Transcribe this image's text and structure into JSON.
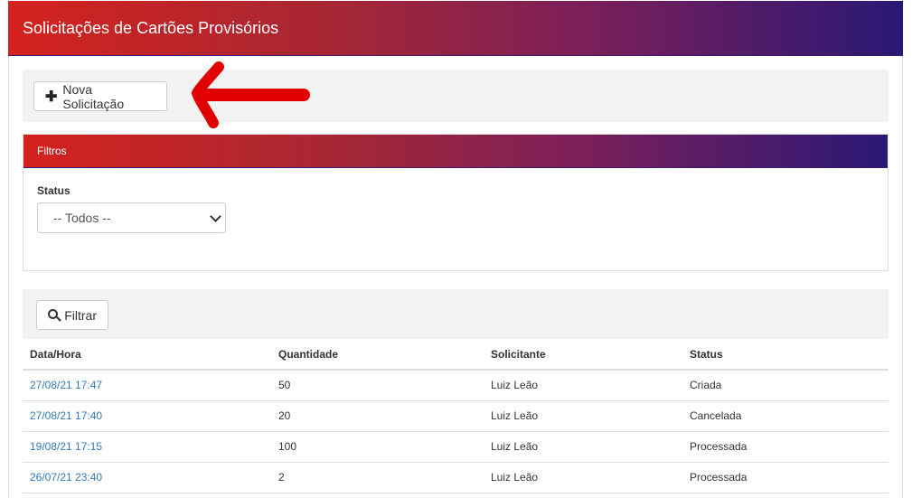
{
  "header": {
    "title": "Solicitações de Cartões Provisórios"
  },
  "toolbar": {
    "new_request_label": "Nova Solicitação"
  },
  "filters": {
    "title": "Filtros",
    "status_label": "Status",
    "status_selected": "-- Todos --"
  },
  "results": {
    "filter_button_label": "Filtrar",
    "columns": [
      "Data/Hora",
      "Quantidade",
      "Solicitante",
      "Status"
    ],
    "rows": [
      {
        "datetime": "27/08/21 17:47",
        "quantity": "50",
        "requester": "Luiz Leão",
        "status": "Criada"
      },
      {
        "datetime": "27/08/21 17:40",
        "quantity": "20",
        "requester": "Luiz Leão",
        "status": "Cancelada"
      },
      {
        "datetime": "19/08/21 17:15",
        "quantity": "100",
        "requester": "Luiz Leão",
        "status": "Processada"
      },
      {
        "datetime": "26/07/21 23:40",
        "quantity": "2",
        "requester": "Luiz Leão",
        "status": "Processada"
      }
    ]
  },
  "colors": {
    "header_gradient_start": "#d4221e",
    "header_gradient_end": "#2a1875",
    "link": "#337ab7",
    "annotation_arrow": "#e00000"
  },
  "icons": {
    "plus": "plus-icon",
    "search": "search-icon",
    "select_caret": "chevron-down-icon"
  }
}
